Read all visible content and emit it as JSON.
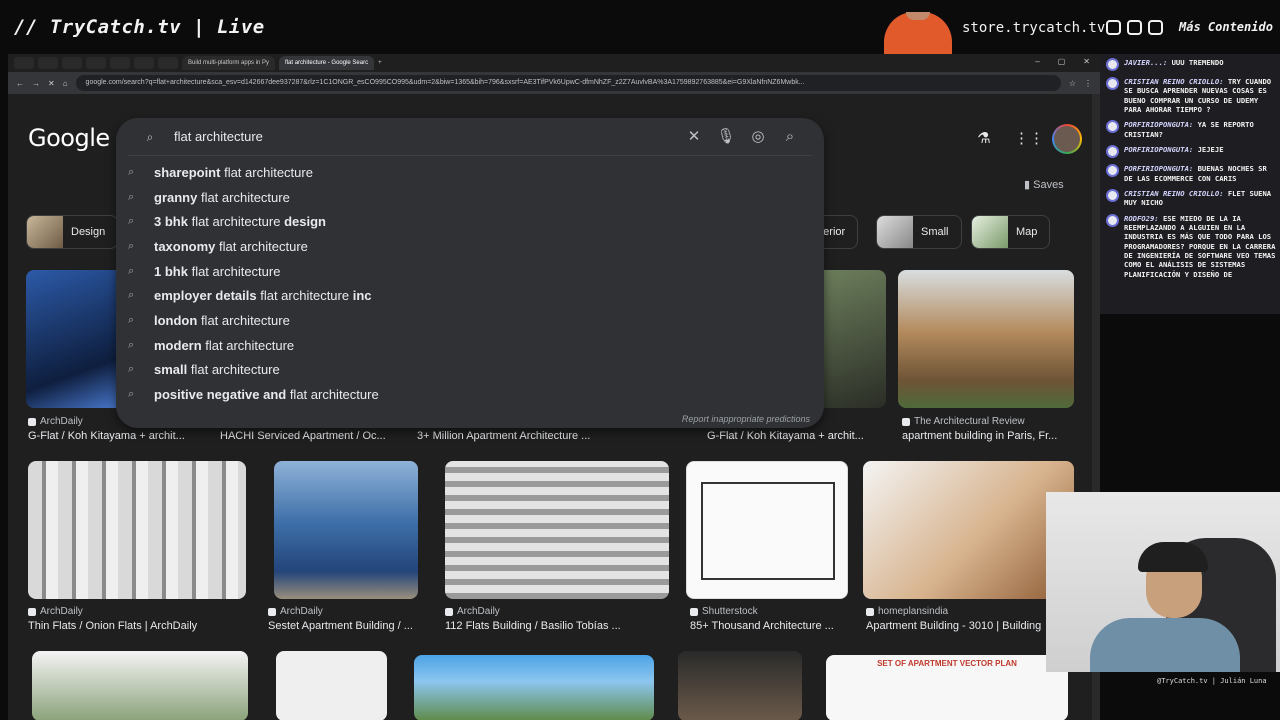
{
  "overlay": {
    "brand": "// TryCatch.tv | Live",
    "store": "store.trycatch.tv",
    "more": "Más Contenido",
    "cam_name": "@TryCatch.tv | Julián Luna"
  },
  "browser": {
    "tabs": [
      {
        "label": "Build multi-platform apps in Py"
      },
      {
        "label": "flat architecture - Google Searc"
      }
    ],
    "url": "google.com/search?q=flat+architecture&sca_esv=d142667dee937287&rlz=1C1ONGR_esCO995CO995&udm=2&biw=1365&bih=796&sxsrf=AE3TifPVk6UpwC-dfmNhZF_z2Z7AuvlvBA%3A1759892763885&ei=G9XlaNfnNZ6Mwbk..."
  },
  "google": {
    "logo": "Google",
    "query": "flat architecture",
    "saves": "Saves",
    "report": "Report inappropriate predictions",
    "suggestions": [
      {
        "bold": "sharepoint",
        "rest": " flat architecture",
        "tail": ""
      },
      {
        "bold": "granny",
        "rest": " flat architecture",
        "tail": ""
      },
      {
        "bold": "3 bhk",
        "rest": " flat architecture ",
        "tail": "design"
      },
      {
        "bold": "taxonomy",
        "rest": " flat architecture",
        "tail": ""
      },
      {
        "bold": "1 bhk",
        "rest": " flat architecture",
        "tail": ""
      },
      {
        "bold": "employer details",
        "rest": " flat architecture ",
        "tail": "inc"
      },
      {
        "bold": "london",
        "rest": " flat architecture",
        "tail": ""
      },
      {
        "bold": "modern",
        "rest": " flat architecture",
        "tail": ""
      },
      {
        "bold": "small",
        "rest": " flat architecture",
        "tail": ""
      },
      {
        "bold": "positive negative and",
        "rest": " flat architecture",
        "tail": ""
      }
    ],
    "chips": [
      "Design",
      "nterior",
      "Small",
      "Map"
    ],
    "row1": [
      {
        "source": "ArchDaily",
        "title": "G-Flat / Koh Kitayama + archit..."
      },
      {
        "source": "",
        "title": "HACHI Serviced Apartment / Oc..."
      },
      {
        "source": "",
        "title": "3+ Million Apartment Architecture ..."
      },
      {
        "source": "",
        "title": "G-Flat / Koh Kitayama + archit..."
      },
      {
        "source": "The Architectural Review",
        "title": "apartment building in Paris, Fr..."
      }
    ],
    "row2": [
      {
        "source": "ArchDaily",
        "title": "Thin Flats / Onion Flats | ArchDaily"
      },
      {
        "source": "ArchDaily",
        "title": "Sestet Apartment Building / ..."
      },
      {
        "source": "ArchDaily",
        "title": "112 Flats Building / Basilio Tobías ..."
      },
      {
        "source": "Shutterstock",
        "title": "85+ Thousand Architecture ..."
      },
      {
        "source": "homeplansindia",
        "title": "Apartment Building - 3010 | Building"
      }
    ],
    "row3_caption": "SET OF APARTMENT VECTOR PLAN"
  },
  "chat": [
    {
      "user": "Javier...:",
      "text": "UUU TREMENDO"
    },
    {
      "user": "Cristian Reino Criollo:",
      "text": "TRY CUANDO SE BUSCA APRENDER NUEVAS COSAS ES BUENO COMPRAR UN CURSO DE UDEMY PARA AHORAR TIEMPO ?"
    },
    {
      "user": "Porfirioponguta:",
      "text": "YA SE REPORTO CRISTIAN?"
    },
    {
      "user": "Porfirioponguta:",
      "text": "JEJEJE"
    },
    {
      "user": "Porfirioponguta:",
      "text": "BUENAS NOCHES SR DE LAS ECOMMERCE CON CARIS"
    },
    {
      "user": "Cristian Reino Criollo:",
      "text": "FLET SUENA MUY NICHO"
    },
    {
      "user": "Rodfo29:",
      "text": "ESE MIEDO DE LA IA REEMPLAZANDO A ALGUIEN EN LA INDUSTRIA ES MÁS QUE TODO PARA LOS PROGRAMADORES? PORQUE EN LA CARRERA DE INGENIERÍA DE SOFTWARE VEO TEMAS COMO EL ANÁLISIS DE SISTEMAS PLANIFICACIÓN Y DISEÑO DE"
    }
  ]
}
